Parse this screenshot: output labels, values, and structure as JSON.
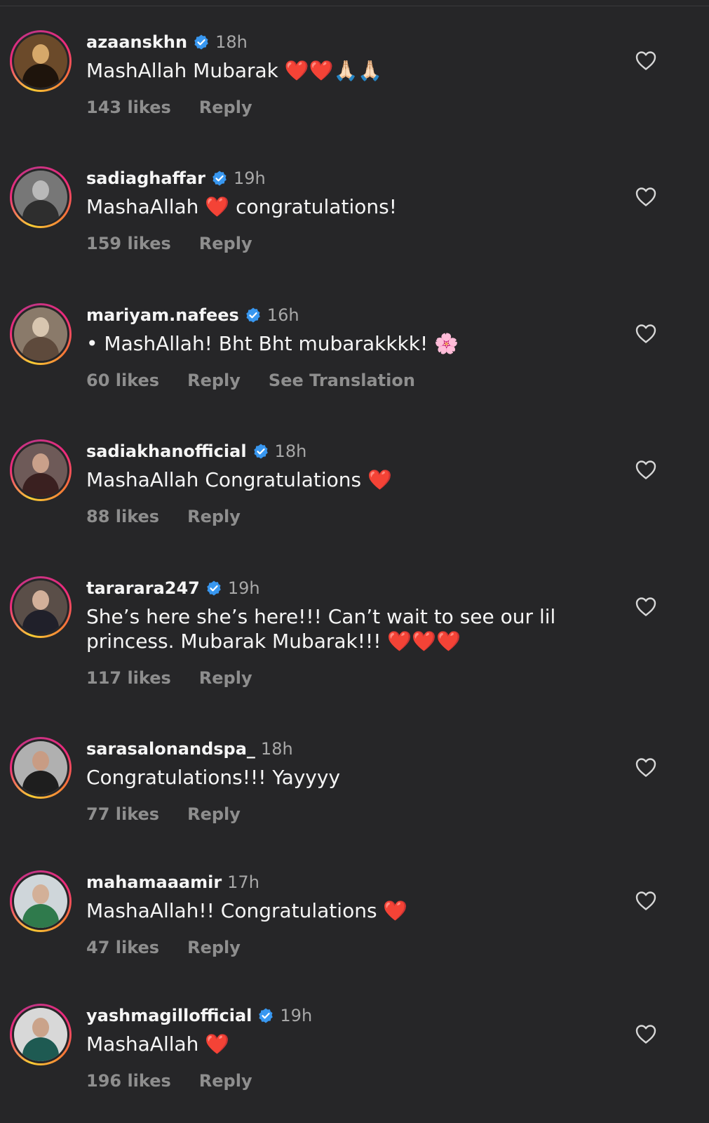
{
  "comments": [
    {
      "username": "azaanskhn",
      "verified": true,
      "time": "18h",
      "text": "MashAllah Mubarak ❤️❤️🙏🏻🙏🏻",
      "likes": "143 likes",
      "reply": "Reply",
      "extra": "",
      "avatar_colors": [
        "#6b4a2a",
        "#1e140c",
        "#d6a86a"
      ]
    },
    {
      "username": "sadiaghaffar",
      "verified": true,
      "time": "19h",
      "text": "MashaAllah ❤️ congratulations!",
      "likes": "159 likes",
      "reply": "Reply",
      "extra": "",
      "avatar_colors": [
        "#777777",
        "#2e2e2e",
        "#b9b9b9"
      ]
    },
    {
      "username": "mariyam.nafees",
      "verified": true,
      "time": "16h",
      "text": "• MashAllah! Bht Bht mubarakkkk! 🌸",
      "likes": "60 likes",
      "reply": "Reply",
      "extra": "See Translation",
      "avatar_colors": [
        "#8a7a6a",
        "#5e4a3c",
        "#d8c6b0"
      ]
    },
    {
      "username": "sadiakhanofficial",
      "verified": true,
      "time": "18h",
      "text": "MashaAllah Congratulations ❤️",
      "likes": "88 likes",
      "reply": "Reply",
      "extra": "",
      "avatar_colors": [
        "#6e5a58",
        "#3a2020",
        "#c9a08a"
      ]
    },
    {
      "username": "tararara247",
      "verified": true,
      "time": "19h",
      "text": "She’s here she’s here!!! Can’t wait to see our lil princess. Mubarak Mubarak!!! ❤️❤️❤️",
      "likes": "117 likes",
      "reply": "Reply",
      "extra": "",
      "avatar_colors": [
        "#5a4e48",
        "#20202a",
        "#d2b09a"
      ]
    },
    {
      "username": "sarasalonandspa_",
      "verified": false,
      "time": "18h",
      "text": "Congratulations!!! Yayyyy",
      "likes": "77 likes",
      "reply": "Reply",
      "extra": "",
      "avatar_colors": [
        "#b0b0b0",
        "#1e1e1e",
        "#c89c84"
      ]
    },
    {
      "username": "mahamaaamir",
      "verified": false,
      "time": "17h",
      "text": "MashaAllah!! Congratulations ❤️",
      "likes": "47 likes",
      "reply": "Reply",
      "extra": "",
      "avatar_colors": [
        "#cfd6da",
        "#2f7a4c",
        "#d3b098"
      ]
    },
    {
      "username": "yashmagillofficial",
      "verified": true,
      "time": "19h",
      "text": "MashaAllah ❤️",
      "likes": "196 likes",
      "reply": "Reply",
      "extra": "",
      "avatar_colors": [
        "#d8d8d8",
        "#1e5a52",
        "#caa38a"
      ]
    }
  ],
  "colors": {
    "background": "#262628",
    "verified": "#3897f0",
    "muted": "#8e8e8e"
  },
  "icons": {
    "verified": "verified-badge-icon",
    "like": "heart-outline-icon"
  }
}
